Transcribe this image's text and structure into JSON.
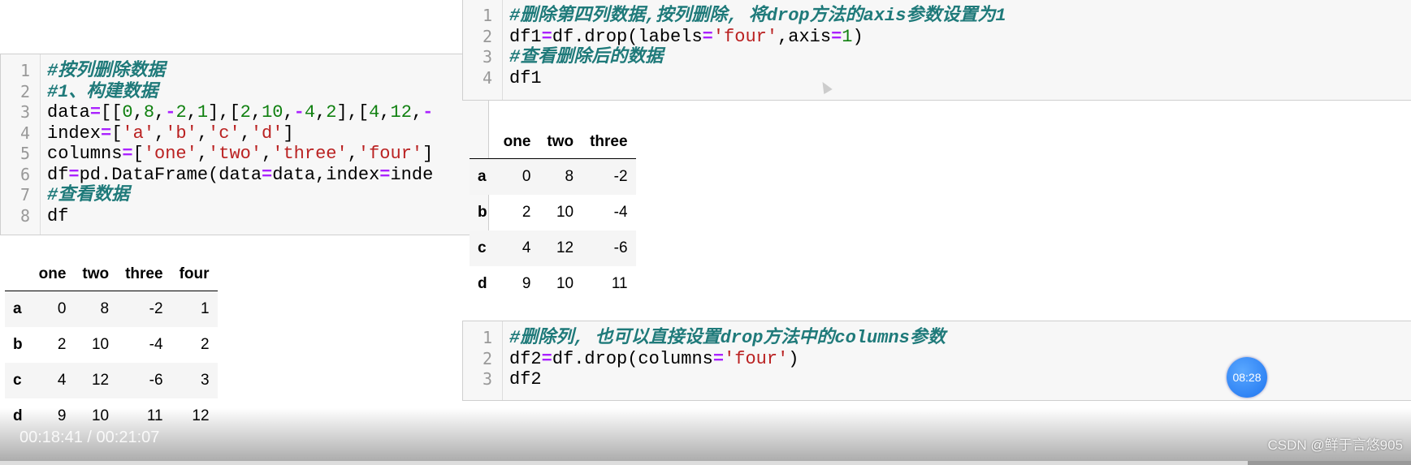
{
  "left_cell": {
    "lines": [
      [
        {
          "t": "#按列删除数据",
          "k": "comment"
        }
      ],
      [
        {
          "t": "#1、构建数据",
          "k": "comment"
        }
      ],
      [
        {
          "t": "data",
          "k": "n"
        },
        {
          "t": "=",
          "k": "op"
        },
        {
          "t": "[[",
          "k": "n"
        },
        {
          "t": "0",
          "k": "num"
        },
        {
          "t": ",",
          "k": "n"
        },
        {
          "t": "8",
          "k": "num"
        },
        {
          "t": ",",
          "k": "n"
        },
        {
          "t": "-",
          "k": "op"
        },
        {
          "t": "2",
          "k": "num"
        },
        {
          "t": ",",
          "k": "n"
        },
        {
          "t": "1",
          "k": "num"
        },
        {
          "t": "],[",
          "k": "n"
        },
        {
          "t": "2",
          "k": "num"
        },
        {
          "t": ",",
          "k": "n"
        },
        {
          "t": "10",
          "k": "num"
        },
        {
          "t": ",",
          "k": "n"
        },
        {
          "t": "-",
          "k": "op"
        },
        {
          "t": "4",
          "k": "num"
        },
        {
          "t": ",",
          "k": "n"
        },
        {
          "t": "2",
          "k": "num"
        },
        {
          "t": "],[",
          "k": "n"
        },
        {
          "t": "4",
          "k": "num"
        },
        {
          "t": ",",
          "k": "n"
        },
        {
          "t": "12",
          "k": "num"
        },
        {
          "t": ",",
          "k": "n"
        },
        {
          "t": "-",
          "k": "op"
        }
      ],
      [
        {
          "t": "index",
          "k": "n"
        },
        {
          "t": "=",
          "k": "op"
        },
        {
          "t": "[",
          "k": "n"
        },
        {
          "t": "'a'",
          "k": "str"
        },
        {
          "t": ",",
          "k": "n"
        },
        {
          "t": "'b'",
          "k": "str"
        },
        {
          "t": ",",
          "k": "n"
        },
        {
          "t": "'c'",
          "k": "str"
        },
        {
          "t": ",",
          "k": "n"
        },
        {
          "t": "'d'",
          "k": "str"
        },
        {
          "t": "]",
          "k": "n"
        }
      ],
      [
        {
          "t": "columns",
          "k": "n"
        },
        {
          "t": "=",
          "k": "op"
        },
        {
          "t": "[",
          "k": "n"
        },
        {
          "t": "'one'",
          "k": "str"
        },
        {
          "t": ",",
          "k": "n"
        },
        {
          "t": "'two'",
          "k": "str"
        },
        {
          "t": ",",
          "k": "n"
        },
        {
          "t": "'three'",
          "k": "str"
        },
        {
          "t": ",",
          "k": "n"
        },
        {
          "t": "'four'",
          "k": "str"
        },
        {
          "t": "]",
          "k": "n"
        }
      ],
      [
        {
          "t": "df",
          "k": "n"
        },
        {
          "t": "=",
          "k": "op"
        },
        {
          "t": "pd.DataFrame(data",
          "k": "n"
        },
        {
          "t": "=",
          "k": "op"
        },
        {
          "t": "data,index",
          "k": "n"
        },
        {
          "t": "=",
          "k": "op"
        },
        {
          "t": "inde",
          "k": "n"
        }
      ],
      [
        {
          "t": "#查看数据",
          "k": "comment"
        }
      ],
      [
        {
          "t": "df",
          "k": "n"
        }
      ]
    ]
  },
  "left_table": {
    "columns": [
      "one",
      "two",
      "three",
      "four"
    ],
    "rows": [
      {
        "index": "a",
        "values": [
          "0",
          "8",
          "-2",
          "1"
        ]
      },
      {
        "index": "b",
        "values": [
          "2",
          "10",
          "-4",
          "2"
        ]
      },
      {
        "index": "c",
        "values": [
          "4",
          "12",
          "-6",
          "3"
        ]
      },
      {
        "index": "d",
        "values": [
          "9",
          "10",
          "11",
          "12"
        ]
      }
    ]
  },
  "top_cell": {
    "lines": [
      [
        {
          "t": "#删除第四列数据,按列删除, 将drop方法的axis参数设置为1",
          "k": "comment"
        }
      ],
      [
        {
          "t": "df1",
          "k": "n"
        },
        {
          "t": "=",
          "k": "op"
        },
        {
          "t": "df.drop(labels",
          "k": "n"
        },
        {
          "t": "=",
          "k": "op"
        },
        {
          "t": "'four'",
          "k": "str"
        },
        {
          "t": ",axis",
          "k": "n"
        },
        {
          "t": "=",
          "k": "op"
        },
        {
          "t": "1",
          "k": "num"
        },
        {
          "t": ")",
          "k": "n"
        }
      ],
      [
        {
          "t": "#查看删除后的数据",
          "k": "comment"
        }
      ],
      [
        {
          "t": "df1",
          "k": "n"
        }
      ]
    ]
  },
  "right_table": {
    "columns": [
      "one",
      "two",
      "three"
    ],
    "rows": [
      {
        "index": "a",
        "values": [
          "0",
          "8",
          "-2"
        ]
      },
      {
        "index": "b",
        "values": [
          "2",
          "10",
          "-4"
        ]
      },
      {
        "index": "c",
        "values": [
          "4",
          "12",
          "-6"
        ]
      },
      {
        "index": "d",
        "values": [
          "9",
          "10",
          "11"
        ]
      }
    ]
  },
  "bottom_cell": {
    "lines": [
      [
        {
          "t": "#删除列, 也可以直接设置drop方法中的columns参数",
          "k": "comment"
        }
      ],
      [
        {
          "t": "df2",
          "k": "n"
        },
        {
          "t": "=",
          "k": "op"
        },
        {
          "t": "df.drop(columns",
          "k": "n"
        },
        {
          "t": "=",
          "k": "op"
        },
        {
          "t": "'four'",
          "k": "str"
        },
        {
          "t": ")",
          "k": "n"
        }
      ],
      [
        {
          "t": "df2",
          "k": "n"
        }
      ]
    ]
  },
  "player": {
    "time": "00:18:41 / 00:21:07",
    "progress_percent": 88.4,
    "clock": "08:28",
    "watermark": "CSDN @鲜于言悠905"
  }
}
